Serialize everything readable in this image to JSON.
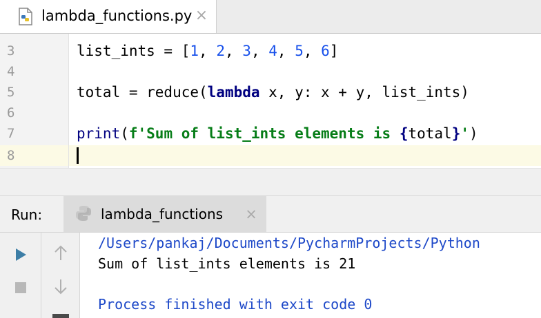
{
  "editor_tab": {
    "file_name": "lambda_functions.py",
    "close_glyph": "×",
    "icon": "python-file-icon"
  },
  "editor": {
    "line_numbers": [
      "3",
      "4",
      "5",
      "6",
      "7",
      "8"
    ],
    "lines": {
      "l3": {
        "a": "list_ints = [",
        "n1": "1",
        "s1": ", ",
        "n2": "2",
        "s2": ", ",
        "n3": "3",
        "s3": ", ",
        "n4": "4",
        "s4": ", ",
        "n5": "5",
        "s5": ", ",
        "n6": "6",
        "b": "]"
      },
      "l5": {
        "a": "total = reduce(",
        "kw": "lambda",
        "b": " x, y: x + y, list_ints)"
      },
      "l7": {
        "fn": "print",
        "p1": "(",
        "str1": "f'Sum of list_ints elements is ",
        "brace1": "{",
        "var": "total",
        "brace2": "}",
        "str2": "'",
        "p2": ")"
      }
    }
  },
  "run_panel": {
    "label": "Run:",
    "tab_label": "lambda_functions",
    "close_glyph": "×",
    "console": {
      "path_line": "/Users/pankaj/Documents/PycharmProjects/Python",
      "output_line": "Sum of list_ints elements is 21",
      "exit_line": "Process finished with exit code 0"
    }
  },
  "colors": {
    "keyword": "#000080",
    "number": "#1750eb",
    "string": "#067d17",
    "console_system": "#1d48c8",
    "current_line": "#fcfae5"
  }
}
